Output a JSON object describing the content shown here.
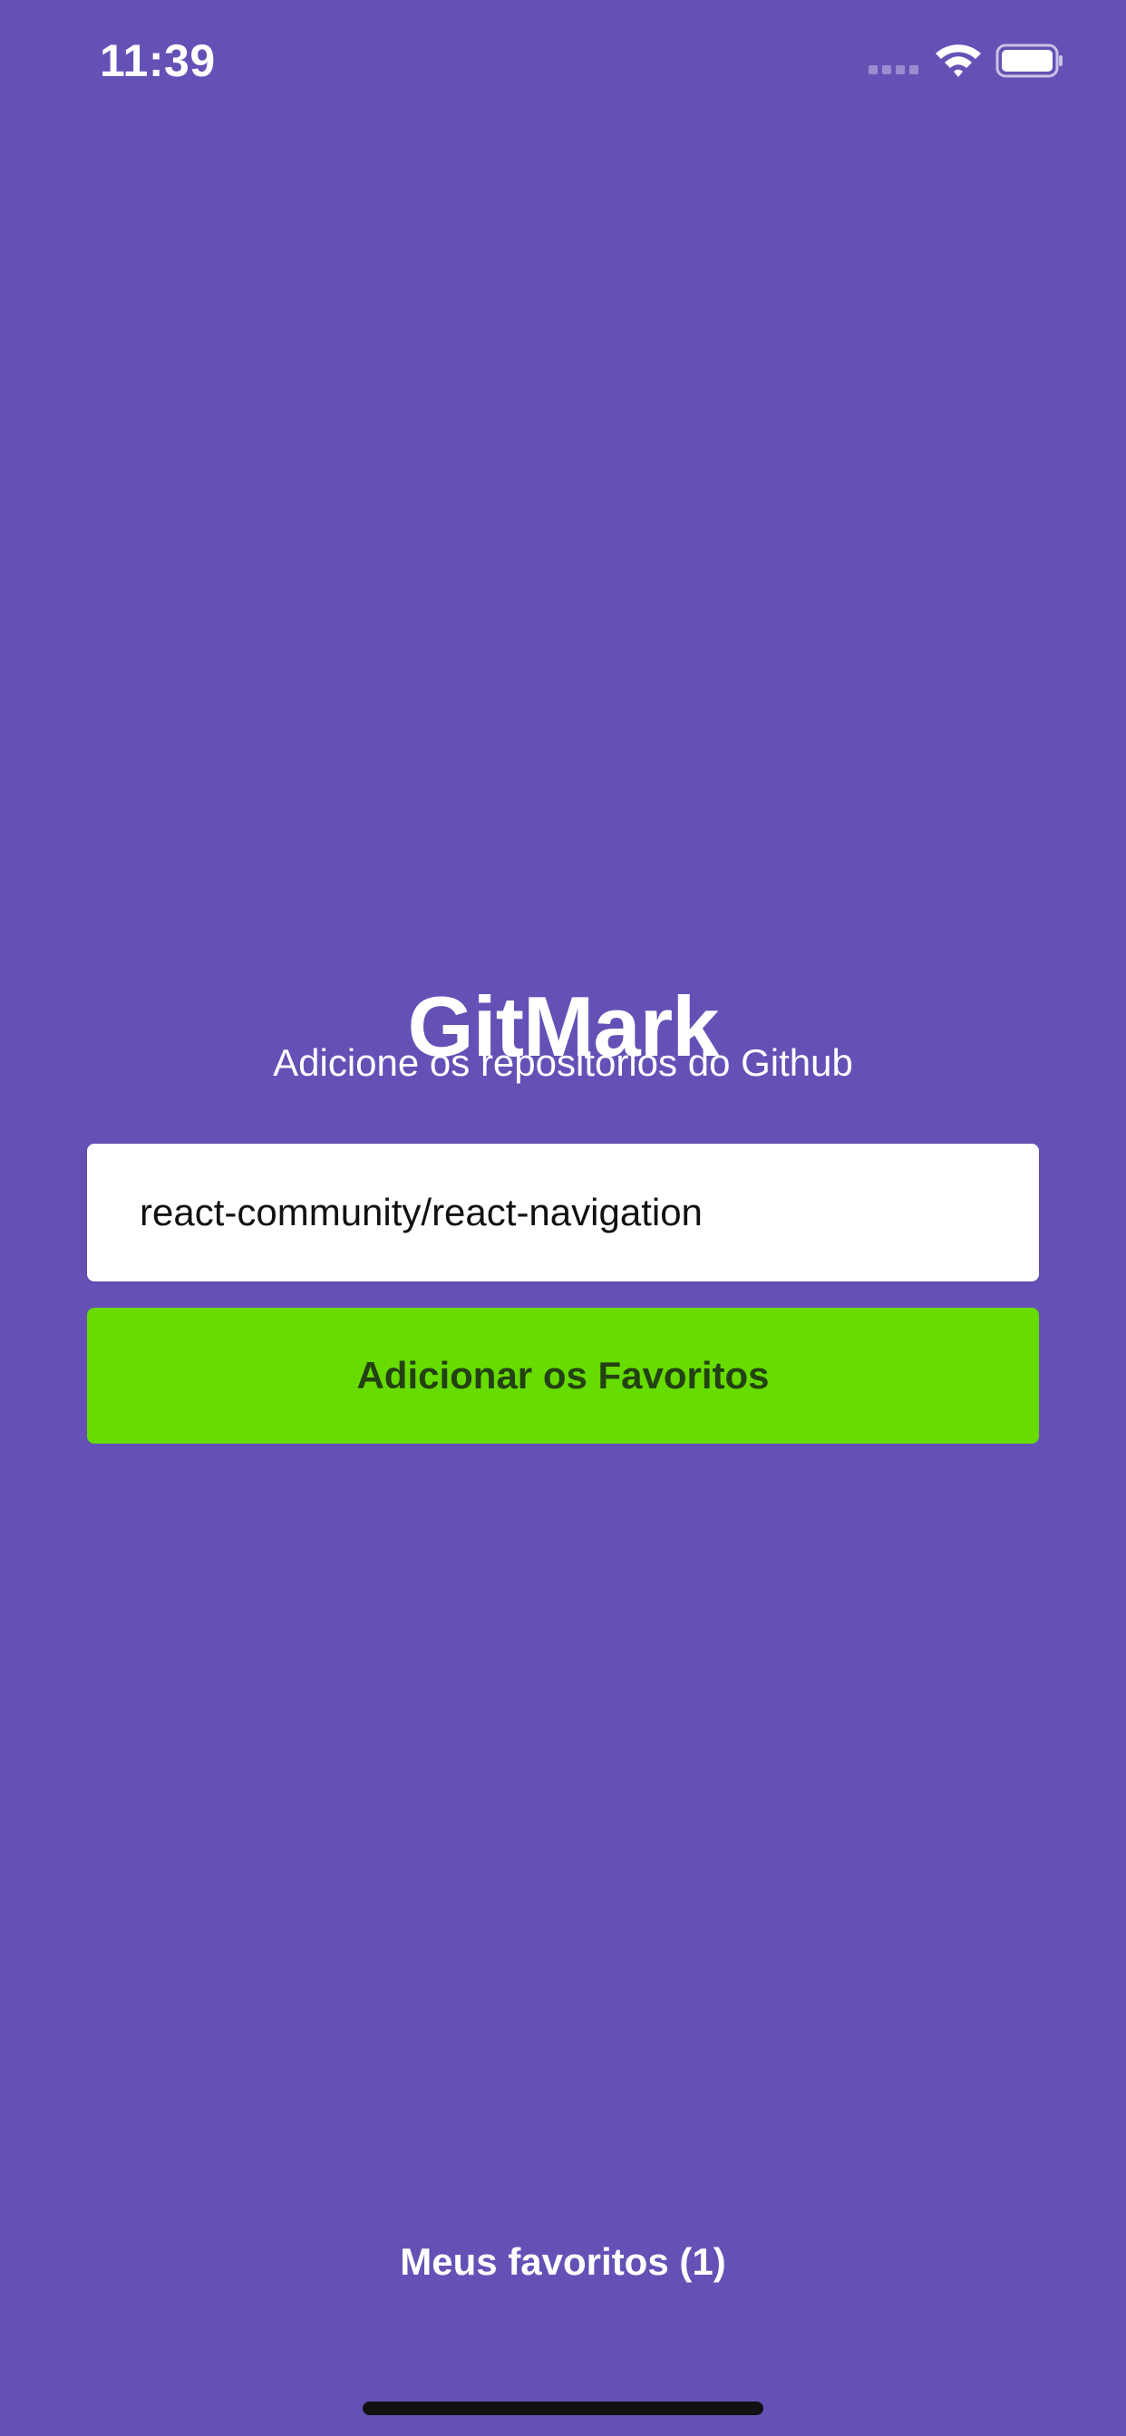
{
  "status_bar": {
    "time": "11:39",
    "signal_icon": "cellular-signal-icon",
    "wifi_icon": "wifi-icon",
    "battery_icon": "battery-icon"
  },
  "app": {
    "title": "GitMark",
    "subtitle": "Adicione os repositórios do Github"
  },
  "form": {
    "repository_value": "react-community/react-navigation",
    "submit_label": "Adicionar os Favoritos"
  },
  "footer": {
    "favorites_label": "Meus favoritos (1)"
  },
  "colors": {
    "background": "#6551b6",
    "button": "#67dc00",
    "button_text": "#234212",
    "input": "#ffffff",
    "text": "#ffffff"
  }
}
